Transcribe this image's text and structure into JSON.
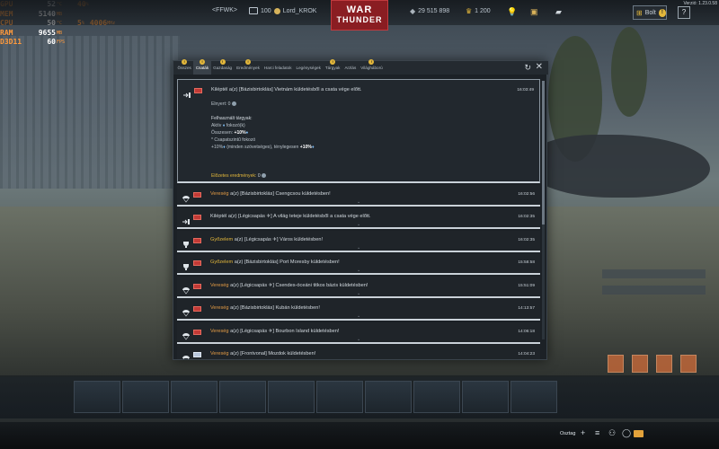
{
  "osd": {
    "rows": [
      {
        "key": "GPU",
        "value": "52",
        "unit": "°C"
      },
      {
        "key": "MEM",
        "value": "5140",
        "unit": "MB"
      },
      {
        "key": "CPU",
        "value": "50",
        "unit": "°C"
      },
      {
        "key": "RAM",
        "value": "9655",
        "unit": "MB"
      },
      {
        "key": "D3D11",
        "value": "60",
        "unit": "FPS"
      }
    ],
    "extra": [
      {
        "value": "40",
        "unit": "%"
      },
      {
        "value": "",
        "unit": ""
      },
      {
        "value": "5",
        "unit": "%"
      }
    ],
    "cpu_clock": "4006",
    "cpu_clock_unit": "MHz"
  },
  "topbar": {
    "squadron": "<FFWK>",
    "player_level": "100",
    "player_name": "Lord_KROK",
    "logo_line1": "WAR",
    "logo_line2": "THUNDER",
    "silver_lions": "29 515 898",
    "golden_eagles": "1 200",
    "shop_label": "Bolt",
    "help_label": "?",
    "version": "Verzió: 1.23.0.58"
  },
  "window": {
    "tabs": [
      {
        "label": "Összes",
        "badge": "!"
      },
      {
        "label": "Csaták",
        "badge": "!",
        "active": true
      },
      {
        "label": "Gazdaság",
        "badge": "!"
      },
      {
        "label": "Eredmények",
        "badge": "!"
      },
      {
        "label": "Harci feladatok",
        "badge": ""
      },
      {
        "label": "Legénységek",
        "badge": ""
      },
      {
        "label": "Tárgyak",
        "badge": "!"
      },
      {
        "label": "Arzlás",
        "badge": ""
      },
      {
        "label": "Világháború",
        "badge": "!"
      }
    ],
    "refresh_label": "↻",
    "close_label": "✕",
    "expanded": {
      "text": "Kiléptél a(z) [Bázisbirtoklás] Vietnám küldetésből a csata vége előtt.",
      "time": "16:03:49",
      "earned_label": "Elnyert: 0",
      "used_items_label": "Felhasznált tárgyak:",
      "active_boost": "Aktív",
      "active_boost_suffix": "fokozó(k)",
      "total_label": "Összesen:",
      "total_value": "+10%",
      "squad_booster": "* Csapatszintű fokozó",
      "detail_prefix": "+10%",
      "detail_mid": "(minden szövetséges), ténylegesen",
      "detail_value": "+10%",
      "prelim_label": "Előzetes eredmények:",
      "prelim_value": "0"
    },
    "entries": [
      {
        "icon": "parachute",
        "result": "Vereség",
        "result_type": "lose",
        "text": "a(z) [Bázisbirtoklás] Csengcsou küldetésben!",
        "time": "16:02:56",
        "flag": "red"
      },
      {
        "icon": "exit",
        "result": "",
        "result_type": "",
        "text": "Kiléptél a(z) [Légicsapás ✈] A világ teteje küldetésből a csata vége előtt.",
        "time": "16:02:35",
        "flag": "red"
      },
      {
        "icon": "trophy",
        "result": "Győzelem",
        "result_type": "win",
        "text": "a(z) [Légicsapás ✈] Város küldetésben!",
        "time": "16:02:35",
        "flag": "red"
      },
      {
        "icon": "trophy",
        "result": "Győzelem",
        "result_type": "win",
        "text": "a(z) [Bázisbirtoklás] Port Moresby küldetésben!",
        "time": "15:58:58",
        "flag": "red"
      },
      {
        "icon": "parachute",
        "result": "Vereség",
        "result_type": "lose",
        "text": "a(z) [Légicsapás ✈] Csendes-óceáni titkos bázis küldetésben!",
        "time": "15:51:09",
        "flag": "red"
      },
      {
        "icon": "parachute",
        "result": "Vereség",
        "result_type": "lose",
        "text": "a(z) [Bázisbirtoklás] Kubán küldetésben!",
        "time": "14:13:57",
        "flag": "red"
      },
      {
        "icon": "parachute",
        "result": "Vereség",
        "result_type": "lose",
        "text": "a(z) [Légicsapás ✈] Bourbon Island küldetésben!",
        "time": "14:06:18",
        "flag": "red"
      },
      {
        "icon": "parachute",
        "result": "Vereség",
        "result_type": "lose",
        "text": "a(z) [Frontvonal] Mozdok küldetésben!",
        "time": "14:04:23",
        "flag": "blue"
      }
    ]
  },
  "bottombar": {
    "squad_label": "Osztag"
  },
  "colors": {
    "accent_gold": "#e3b73b",
    "defeat_orange": "#e39b45",
    "osd_orange": "#ff9a3c",
    "logo_red": "#8a1d22"
  }
}
